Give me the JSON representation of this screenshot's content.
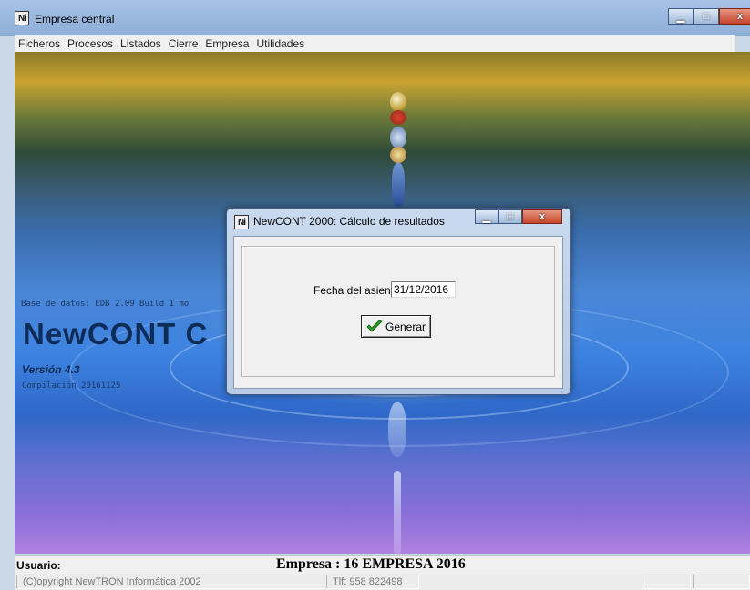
{
  "main_window": {
    "title": "Empresa central",
    "controls": {
      "minimize": "▁",
      "maximize": "□",
      "close": "x"
    }
  },
  "menu": [
    "Ficheros",
    "Procesos",
    "Listados",
    "Cierre",
    "Empresa",
    "Utilidades"
  ],
  "splash": {
    "database": "Base de datos: EDB 2.09 Build 1 mo",
    "app_name": "NewCONT C",
    "version": "Versión 4.3",
    "build": "Compilación 20161125"
  },
  "status": {
    "usuario_label": "Usuario:",
    "empresa": "Empresa : 16 EMPRESA 2016",
    "copyright": "(C)opyright NewTRON Informática 2002",
    "phone": "Tlf: 958 822498"
  },
  "dialog": {
    "title": "NewCONT 2000: Cálculo de resultados",
    "fecha_label": "Fecha del asiento:",
    "fecha_value": "31/12/2016",
    "generate_label": "Generar",
    "controls": {
      "minimize": "▁",
      "maximize": "□",
      "close": "x"
    }
  },
  "colors": {
    "title_bar": "#9bb9df",
    "close_button": "#c6442c",
    "splash_text": "#0e2c58"
  }
}
